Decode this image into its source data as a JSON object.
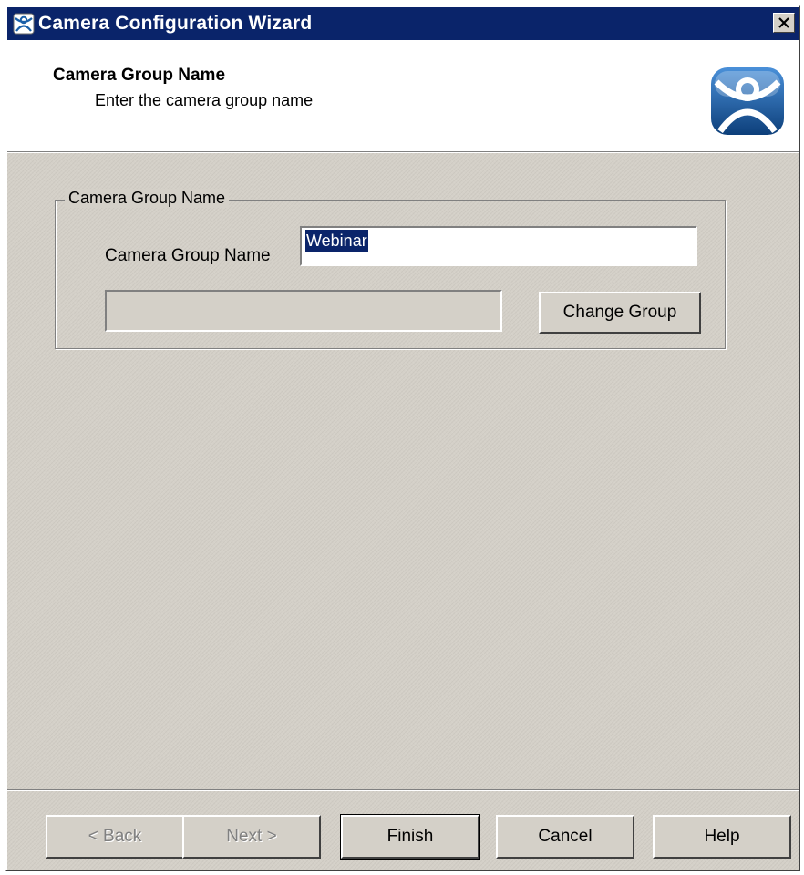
{
  "window": {
    "title": "Camera Configuration Wizard"
  },
  "header": {
    "title": "Camera Group Name",
    "subtitle": "Enter the camera group name"
  },
  "groupbox": {
    "legend": "Camera Group Name",
    "field_label": "Camera Group Name",
    "name_value": "Webinar",
    "group_display_value": "",
    "change_group_label": "Change Group"
  },
  "footer": {
    "back_label": "< Back",
    "next_label": "Next >",
    "finish_label": "Finish",
    "cancel_label": "Cancel",
    "help_label": "Help"
  },
  "colors": {
    "titlebar": "#0a246a",
    "dialog_face": "#d4d0c8",
    "selection": "#0a246a",
    "logo_blue": "#1a5fa8"
  },
  "icons": {
    "app": "thinmanager-person-icon",
    "close": "close-icon",
    "logo": "thinmanager-logo-icon"
  }
}
